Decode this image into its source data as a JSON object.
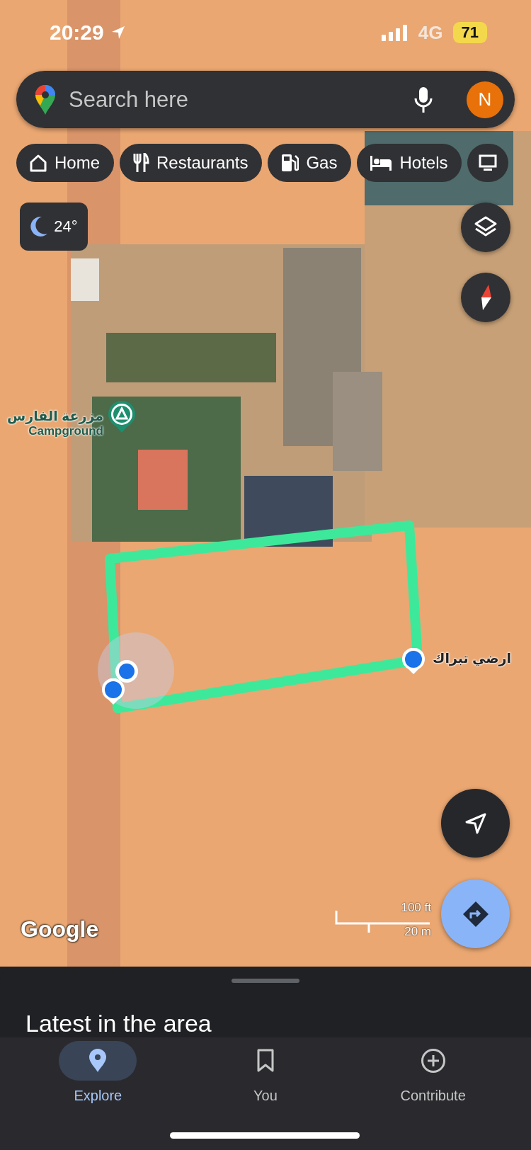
{
  "status_bar": {
    "time": "20:29",
    "network": "4G",
    "battery": "71"
  },
  "search": {
    "placeholder": "Search here",
    "avatar_letter": "N"
  },
  "chips": [
    {
      "label": "Home",
      "kind": "home"
    },
    {
      "label": "Restaurants",
      "kind": "restaurant"
    },
    {
      "label": "Gas",
      "kind": "gas"
    },
    {
      "label": "Hotels",
      "kind": "hotel"
    },
    {
      "kind": "screen"
    }
  ],
  "weather": {
    "temperature": "24°"
  },
  "map": {
    "places": [
      {
        "name": "مزرعة الفارس",
        "category": "Campground",
        "kind": "campground"
      },
      {
        "name": "ارضي تبراك",
        "kind": "pin"
      }
    ],
    "attribution": "Google",
    "scale": {
      "imperial": "100 ft",
      "metric": "20 m"
    }
  },
  "sheet": {
    "title": "Latest in the area"
  },
  "tabs": [
    {
      "label": "Explore",
      "kind": "explore",
      "selected": true
    },
    {
      "label": "You",
      "kind": "saved",
      "selected": false
    },
    {
      "label": "Contribute",
      "kind": "contribute",
      "selected": false
    }
  ]
}
